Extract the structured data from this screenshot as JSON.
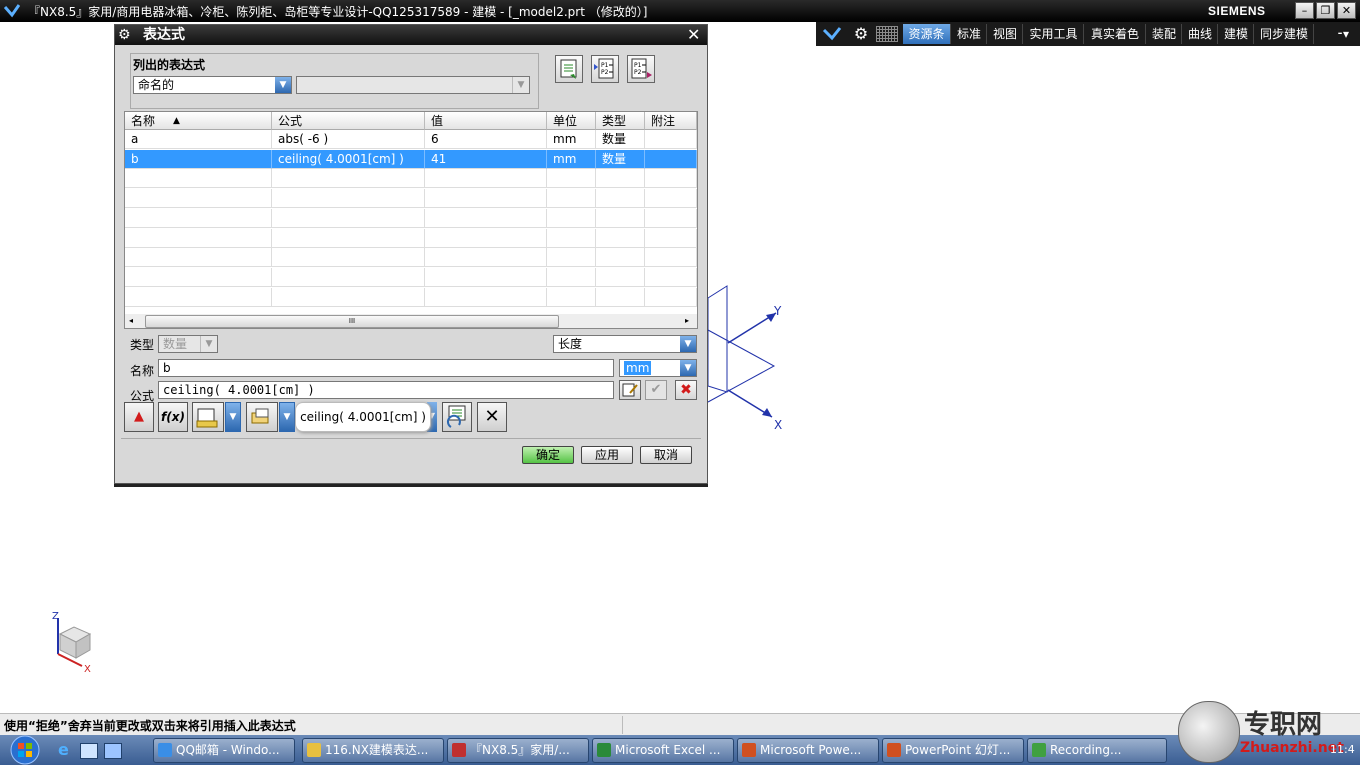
{
  "window": {
    "title": "『NX8.5』家用/商用电器冰箱、冷柜、陈列柜、岛柜等专业设计-QQ125317589 - 建模 - [_model2.prt （修改的）]",
    "brand": "SIEMENS"
  },
  "ribbon": {
    "tabs": [
      "资源条",
      "标准",
      "视图",
      "实用工具",
      "真实着色",
      "装配",
      "曲线",
      "建模",
      "同步建模"
    ],
    "active_tab": "资源条"
  },
  "dialog": {
    "title": "表达式",
    "list_group_label": "列出的表达式",
    "list_filter_value": "命名的",
    "table": {
      "headers": [
        "名称",
        "公式",
        "值",
        "单位",
        "类型",
        "附注"
      ],
      "rows": [
        {
          "name": "a",
          "formula": "abs( -6 )",
          "value": "6",
          "unit": "mm",
          "type": "数量",
          "note": ""
        },
        {
          "name": "b",
          "formula": "ceiling( 4.0001[cm] )",
          "value": "41",
          "unit": "mm",
          "type": "数量",
          "note": ""
        }
      ],
      "selected_row": 1,
      "scroll_grip": "III"
    },
    "type_label": "类型",
    "type_value": "数量",
    "dimension_value": "长度",
    "name_label": "名称",
    "name_value": "b",
    "unit_value": "mm",
    "formula_label": "公式",
    "formula_value": "ceiling( 4.0001[cm] )",
    "tooltip": "ceiling( 4.0001[cm] )",
    "buttons": {
      "ok": "确定",
      "apply": "应用",
      "cancel": "取消"
    }
  },
  "viewport": {
    "axis_labels": {
      "x": "X",
      "y": "Y",
      "z": "Z"
    }
  },
  "status_bar": {
    "message": "使用“拒绝”舍弃当前更改或双击来将引用插入此表达式"
  },
  "taskbar": {
    "items": [
      {
        "label": "QQ邮箱 - Windo...",
        "color": "#3a8ee6"
      },
      {
        "label": "116.NX建模表达...",
        "color": "#e8c040"
      },
      {
        "label": "『NX8.5』家用/...",
        "color": "#c03030"
      },
      {
        "label": "Microsoft Excel ...",
        "color": "#2a8a3a"
      },
      {
        "label": "Microsoft Powe...",
        "color": "#d05020"
      },
      {
        "label": "PowerPoint 幻灯...",
        "color": "#d05020"
      },
      {
        "label": "Recording...",
        "color": "#40a040"
      }
    ],
    "clock": "11:4"
  },
  "watermark": {
    "text": "专职网",
    "url": "Zhuanzhi.net"
  }
}
